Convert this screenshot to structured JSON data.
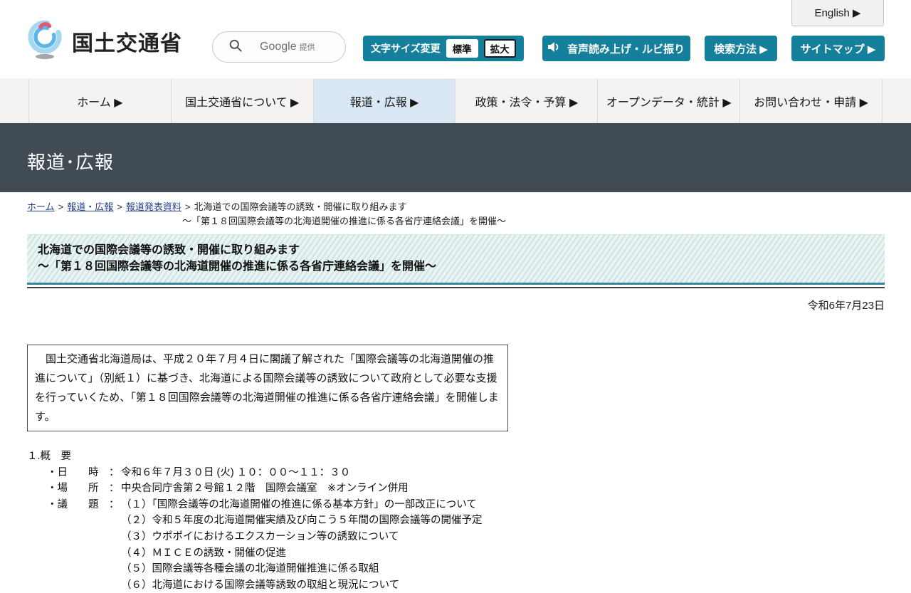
{
  "header": {
    "english_label": "English ▶",
    "logo_text": "国土交通省",
    "search": {
      "provider_main": "Google",
      "provider_sub": "提供"
    },
    "font_size": {
      "label": "文字サイズ変更",
      "standard": "標準",
      "large": "拡大"
    },
    "tts_label": "音声読み上げ・ルビ振り",
    "search_method_label": "検索方法 ▶",
    "sitemap_label": "サイトマップ ▶"
  },
  "nav": {
    "items": [
      {
        "label": "ホーム ▶"
      },
      {
        "label": "国土交通省について ▶"
      },
      {
        "label": "報道・広報 ▶"
      },
      {
        "label": "政策・法令・予算 ▶"
      },
      {
        "label": "オープンデータ・統計 ▶"
      },
      {
        "label": "お問い合わせ・申請 ▶"
      }
    ]
  },
  "page": {
    "section_title": "報道･広報",
    "breadcrumb": {
      "links": [
        "ホーム",
        "報道・広報",
        "報道発表資料"
      ],
      "separator": ">",
      "current_line1": "北海道での国際会議等の誘致・開催に取り組みます",
      "current_line2": "～「第１８回国際会議等の北海道開催の推進に係る各省庁連絡会議」を開催～"
    },
    "headline": {
      "line1": "北海道での国際会議等の誘致・開催に取り組みます",
      "line2": "～「第１８回国際会議等の北海道開催の推進に係る各省庁連絡会議」を開催～"
    },
    "date": "令和6年7月23日",
    "lead_paragraph": "　国土交通省北海道局は、平成２０年７月４日に閣議了解された「国際会議等の北海道開催の推進について」（別紙１）に基づき、北海道による国際会議等の誘致について政府として必要な支援を行っていくため、「第１８回国際会議等の北海道開催の推進に係る各省庁連絡会議」を開催します。",
    "overview": {
      "heading": "１.概　要",
      "datetime_label": "・日　　時　：",
      "datetime_value": "令和６年７月３０日 (火) １０：００～１１：３０",
      "place_label": "・場　　所　：",
      "place_value": "中央合同庁舎第２号館１２階　国際会議室　※オンライン併用",
      "agenda_label": "・議　　題　：",
      "agenda": [
        "（１）「国際会議等の北海道開催の推進に係る基本方針」の一部改正について",
        "（２）令和５年度の北海道開催実績及び向こう５年間の国際会議等の開催予定",
        "（３）ウポポイにおけるエクスカーション等の誘致について",
        "（４）ＭＩＣＥの誘致・開催の促進",
        "（５）国際会議等各種会議の北海道開催推進に係る取組",
        "（６）北海道における国際会議等誘致の取組と現況について"
      ]
    }
  },
  "colors": {
    "teal_button": "#15809b",
    "nav_active_bg": "#d8e7f3",
    "band_bg": "#404b53",
    "headline_box_bg": "#eaf4f3",
    "headline_border": "#36879a",
    "link_blue": "#26418c"
  }
}
